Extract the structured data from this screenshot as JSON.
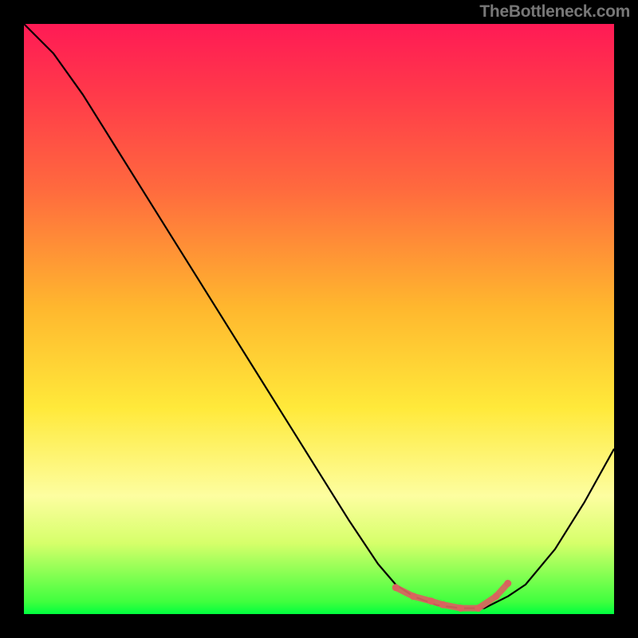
{
  "watermark": "TheBottleneck.com",
  "chart_data": {
    "type": "line",
    "title": "",
    "xlabel": "",
    "ylabel": "",
    "x": [
      0.0,
      0.05,
      0.1,
      0.15,
      0.2,
      0.25,
      0.3,
      0.35,
      0.4,
      0.45,
      0.5,
      0.55,
      0.6,
      0.63,
      0.66,
      0.7,
      0.74,
      0.78,
      0.82,
      0.85,
      0.9,
      0.95,
      1.0
    ],
    "values": [
      1.0,
      0.95,
      0.88,
      0.8,
      0.72,
      0.64,
      0.56,
      0.48,
      0.4,
      0.32,
      0.24,
      0.16,
      0.085,
      0.05,
      0.03,
      0.015,
      0.01,
      0.01,
      0.03,
      0.05,
      0.11,
      0.19,
      0.28
    ],
    "annotations": {
      "optimum_band_x": [
        0.66,
        0.82
      ],
      "dot_markers_x": [
        0.63,
        0.66,
        0.69,
        0.71,
        0.74,
        0.77,
        0.8,
        0.82
      ],
      "dot_markers_y": [
        0.045,
        0.03,
        0.022,
        0.016,
        0.01,
        0.01,
        0.03,
        0.052
      ]
    },
    "xlim": [
      0,
      1
    ],
    "ylim": [
      0,
      1
    ],
    "colors": {
      "line": "#000000",
      "markers": "#d9635e",
      "bg_top": "#ff1a55",
      "bg_mid": "#ffe93a",
      "bg_bottom": "#00ff3f"
    }
  }
}
